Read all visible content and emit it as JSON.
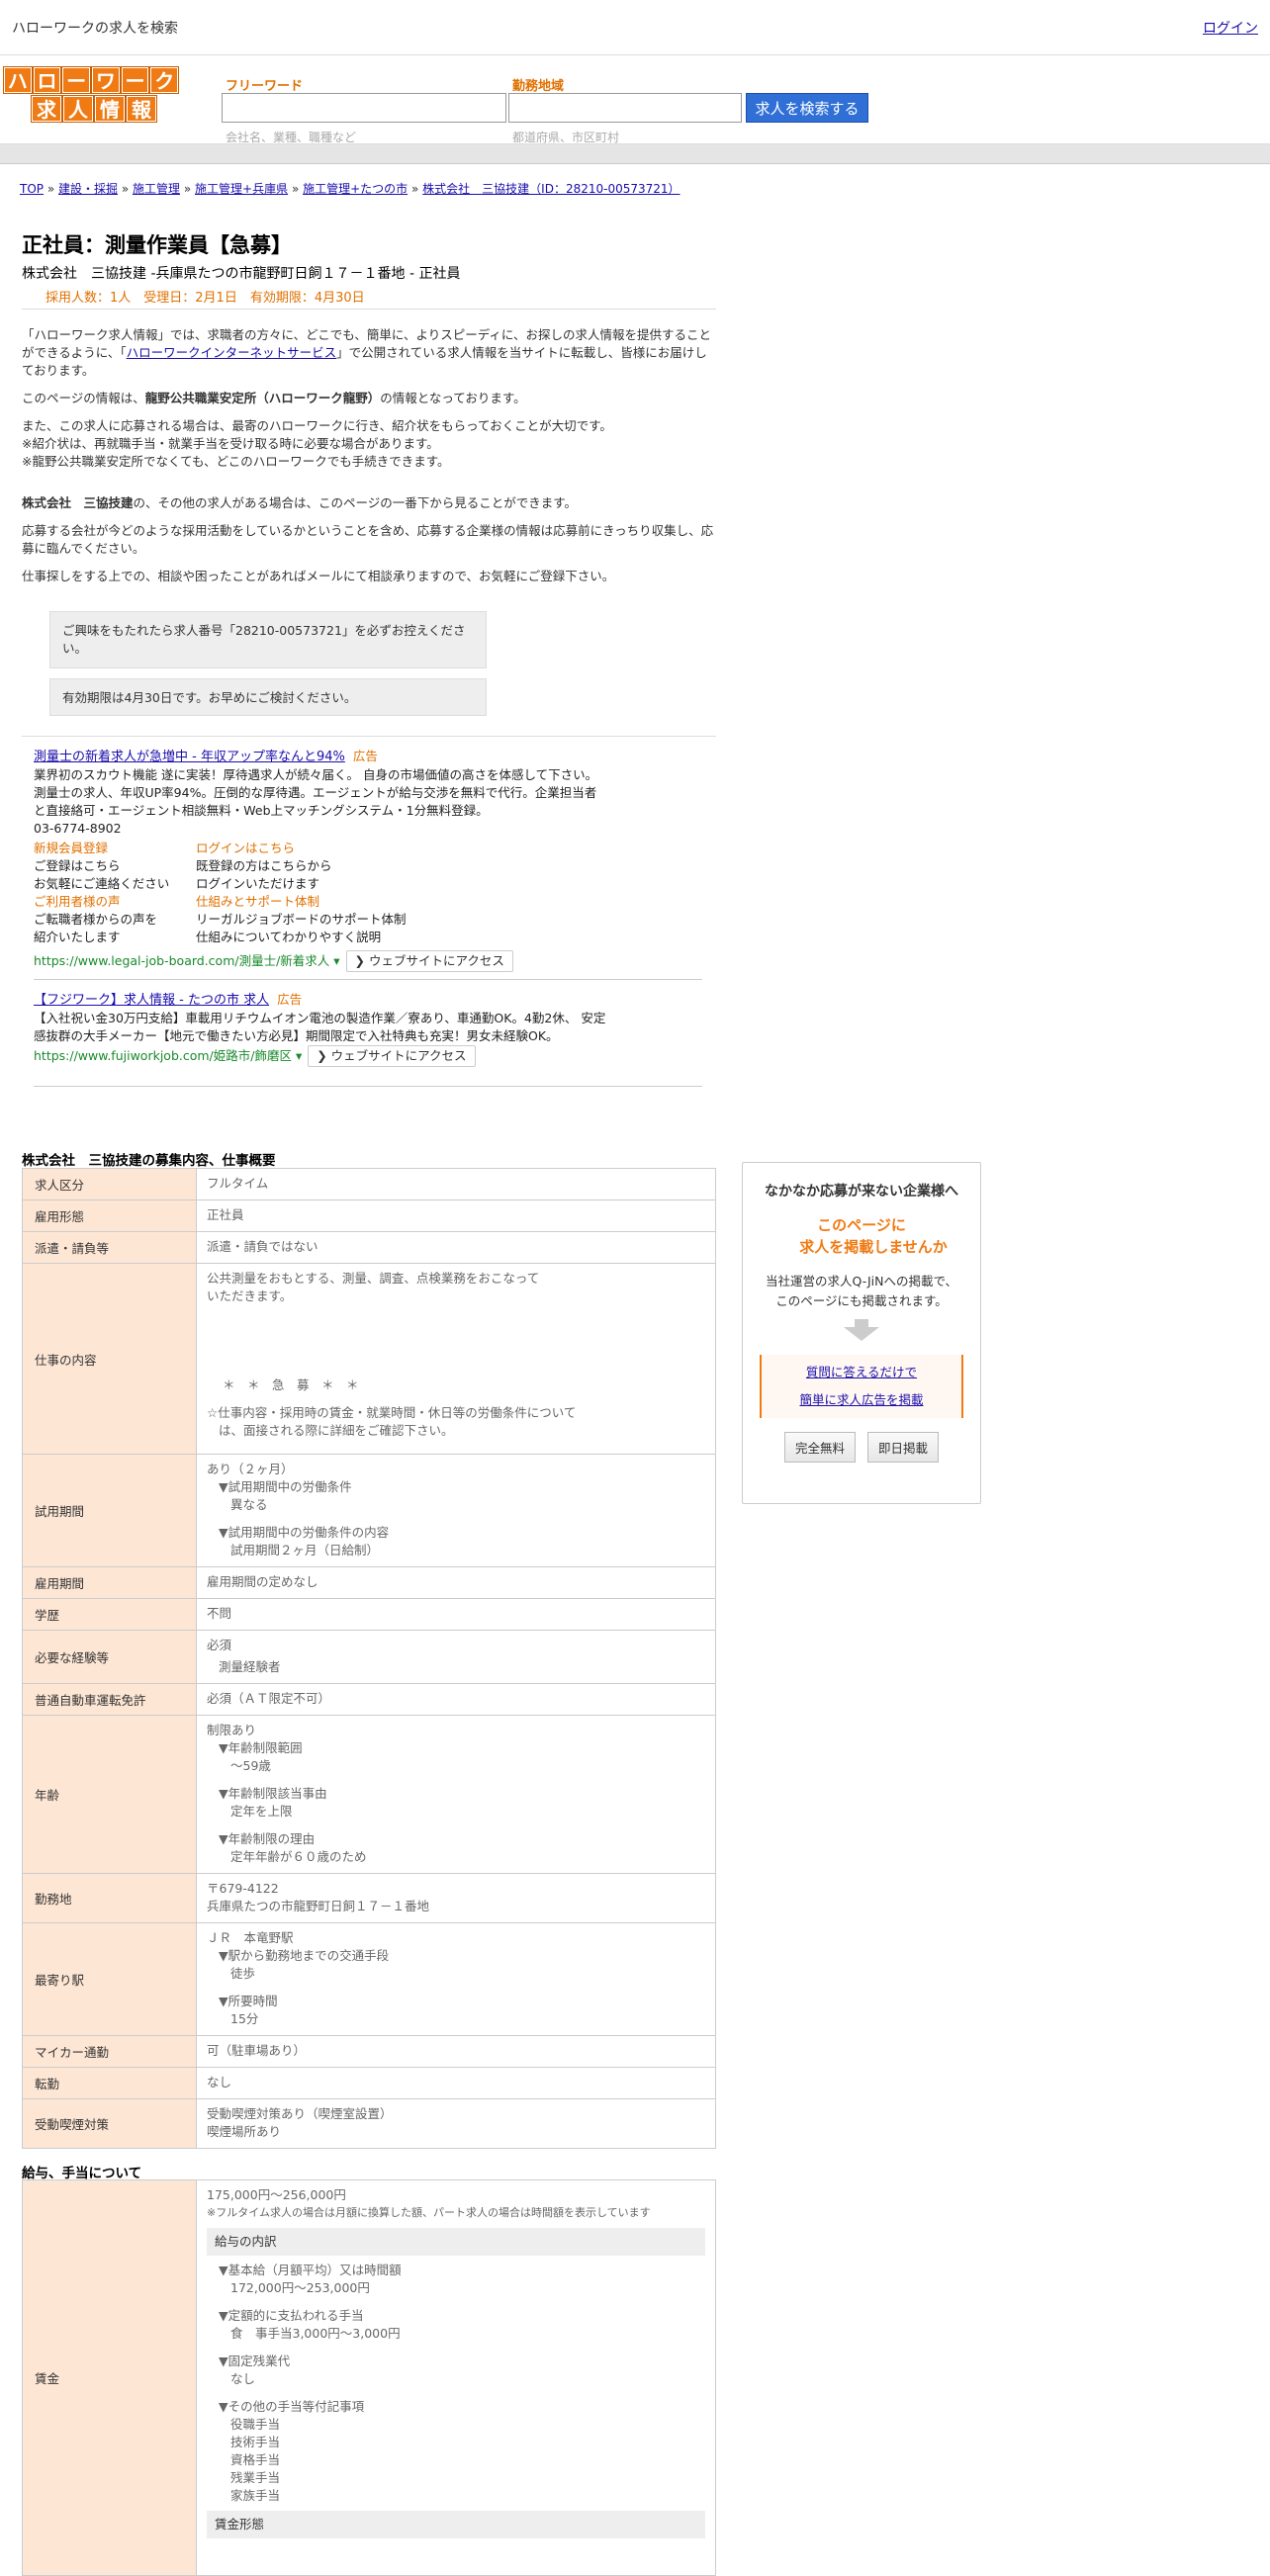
{
  "topbar": {
    "search_link": "ハローワークの求人を検索",
    "login": "ログイン"
  },
  "logo": {
    "row1": [
      "ハ",
      "ロ",
      "ー",
      "ワ",
      "ー",
      "ク"
    ],
    "row2": [
      "求",
      "人",
      "情",
      "報"
    ]
  },
  "search": {
    "freeword_label": "フリーワード",
    "freeword_hint": "会社名、業種、職種など",
    "area_label": "勤務地域",
    "area_hint": "都道府県、市区町村",
    "button": "求人を検索する"
  },
  "breadcrumb": {
    "items": [
      "TOP",
      "建設・採掘",
      "施工管理",
      "施工管理+兵庫県",
      "施工管理+たつの市",
      "株式会社　三協技建（ID：28210-00573721）"
    ],
    "sep": "»"
  },
  "job": {
    "title": "正社員：測量作業員【急募】",
    "company_line": "株式会社　三協技建 -兵庫県たつの市龍野町日飼１７－１番地 - 正社員",
    "meta": "採用人数：1人　受理日：2月1日　有効期限：4月30日"
  },
  "intro": {
    "p1_a": "「ハローワーク求人情報」では、求職者の方々に、どこでも、簡単に、よりスピーディに、お探しの求人情報を提供することができるように、「",
    "p1_link": "ハローワークインターネットサービス",
    "p1_b": "」で公開されている求人情報を当サイトに転載し、皆様にお届けしております。",
    "p2_a": "このページの情報は、",
    "p2_bold": "龍野公共職業安定所（ハローワーク龍野）",
    "p2_b": "の情報となっております。",
    "p3_1": "また、この求人に応募される場合は、最寄のハローワークに行き、紹介状をもらっておくことが大切です。",
    "p3_2": "※紹介状は、再就職手当・就業手当を受け取る時に必要な場合があります。",
    "p3_3": "※龍野公共職業安定所でなくても、どこのハローワークでも手続きできます。",
    "p4_bold": "株式会社　三協技建",
    "p4_b": "の、その他の求人がある場合は、このページの一番下から見ることができます。",
    "p5": "応募する会社が今どのような採用活動をしているかということを含め、応募する企業様の情報は応募前にきっちり収集し、応募に臨んでください。",
    "p6": "仕事探しをする上での、相談や困ったことがあればメールにて相談承りますので、お気軽にご登録下さい。"
  },
  "notices": {
    "n1": "ご興味をもたれたら求人番号「28210-00573721」を必ずお控えください。",
    "n2": "有効期限は4月30日です。お早めにご検討ください。"
  },
  "ad1": {
    "title": "測量士の新着求人が急増中 - 年収アップ率なんと94%",
    "tag": "広告",
    "body1": "業界初のスカウト機能 遂に実装！厚待遇求人が続々届く。 自身の市場価値の高さを体感して下さい。",
    "body2": "測量士の求人、年収UP率94%。圧倒的な厚待遇。エージェントが給与交渉を無料で代行。企業担当者",
    "body3": "と直接絡可・エージェント相談無料・Web上マッチングシステム・1分無料登録。",
    "phone": "03-6774-8902",
    "sitelinks": [
      {
        "title": "新規会員登録",
        "l1": "ご登録はこちら",
        "l2": "お気軽にご連絡ください"
      },
      {
        "title": "ログインはこちら",
        "l1": "既登録の方はこちらから",
        "l2": "ログインいただけます"
      },
      {
        "title": "ご利用者様の声",
        "l1": "ご転職者様からの声を",
        "l2": "紹介いたします"
      },
      {
        "title": "仕組みとサポート体制",
        "l1": "リーガルジョブボードのサポート体制",
        "l2": "仕組みについてわかりやすく説明"
      }
    ],
    "url": "https://www.legal-job-board.com/測量士/新着求人 ▾",
    "visit": "❯ ウェブサイトにアクセス"
  },
  "ad2": {
    "title": "【フジワーク】求人情報 - たつの市 求人",
    "tag": "広告",
    "body1": "【入社祝い金30万円支給】車載用リチウムイオン電池の製造作業／寮あり、車通勤OK。4勤2休、 安定",
    "body2": "感抜群の大手メーカー【地元で働きたい方必見】期間限定で入社特典も充実！男女未経験OK。",
    "url": "https://www.fujiworkjob.com/姫路市/飾磨区 ▾",
    "visit": "❯ ウェブサイトにアクセス"
  },
  "section1_title": "株式会社　三協技建の募集内容、仕事概要",
  "table1": {
    "r1_h": "求人区分",
    "r1_v": "フルタイム",
    "r2_h": "雇用形態",
    "r2_v": "正社員",
    "r3_h": "派遣・請負等",
    "r3_v": "派遣・請負ではない",
    "r4_h": "仕事の内容",
    "r4_v1": "公共測量をおもとする、測量、調査、点検業務をおこなって",
    "r4_v2": "いただきます。",
    "r4_v3": "＊　＊　急　募　＊　＊",
    "r4_v4": "☆仕事内容・採用時の賃金・就業時間・休日等の労働条件について",
    "r4_v5": "は、面接される際に詳細をご確認下さい。",
    "r5_h": "試用期間",
    "r5_v1": "あり（２ヶ月）",
    "r5_v2": "▼試用期間中の労働条件",
    "r5_v3": "異なる",
    "r5_v4": "▼試用期間中の労働条件の内容",
    "r5_v5": "試用期間２ヶ月（日給制）",
    "r6_h": "雇用期間",
    "r6_v": "雇用期間の定めなし",
    "r7_h": "学歴",
    "r7_v": "不問",
    "r8_h": "必要な経験等",
    "r8_v1": "必須",
    "r8_v2": "測量経験者",
    "r9_h": "普通自動車運転免許",
    "r9_v": "必須（ＡＴ限定不可）",
    "r10_h": "年齢",
    "r10_v1": "制限あり",
    "r10_v2": "▼年齢制限範囲",
    "r10_v3": "〜59歳",
    "r10_v4": "▼年齢制限該当事由",
    "r10_v5": "定年を上限",
    "r10_v6": "▼年齢制限の理由",
    "r10_v7": "定年年齢が６０歳のため",
    "r11_h": "勤務地",
    "r11_v1": "〒679-4122",
    "r11_v2": "兵庫県たつの市龍野町日飼１７－１番地",
    "r12_h": "最寄り駅",
    "r12_v1": "ＪＲ　本竜野駅",
    "r12_v2": "▼駅から勤務地までの交通手段",
    "r12_v3": "徒歩",
    "r12_v4": "▼所要時間",
    "r12_v5": "15分",
    "r13_h": "マイカー通勤",
    "r13_v": "可（駐車場あり）",
    "r14_h": "転勤",
    "r14_v": "なし",
    "r15_h": "受動喫煙対策",
    "r15_v1": "受動喫煙対策あり（喫煙室設置）",
    "r15_v2": "喫煙場所あり"
  },
  "section2_title": "給与、手当について",
  "table2": {
    "h": "賃金",
    "v1": "175,000円〜256,000円",
    "v2": "※フルタイム求人の場合は月額に換算した額、パート求人の場合は時間額を表示しています",
    "head1": "給与の内訳",
    "v3": "▼基本給（月額平均）又は時間額",
    "v4": "172,000円〜253,000円",
    "v5": "▼定額的に支払われる手当",
    "v6": "食　事手当3,000円〜3,000円",
    "v7": "▼固定残業代",
    "v8": "なし",
    "v9": "▼その他の手当等付記事項",
    "v10": [
      "役職手当",
      "技術手当",
      "資格手当",
      "残業手当",
      "家族手当"
    ],
    "head2": "賃金形態"
  },
  "side": {
    "heading": "なかなか応募が来ない企業様へ",
    "orange1": "このページに",
    "orange2": "求人を掲載しませんか",
    "desc1": "当社運営の求人Q-JiNへの掲載で、",
    "desc2": "このページにも掲載されます。",
    "link1": "質問に答えるだけで",
    "link2": "簡単に求人広告を掲載",
    "btn1": "完全無料",
    "btn2": "即日掲載"
  },
  "colors": {
    "brand_orange": "#f07a13",
    "header_th_bg": "#fde6d4",
    "search_button": "#2f6fd6"
  }
}
